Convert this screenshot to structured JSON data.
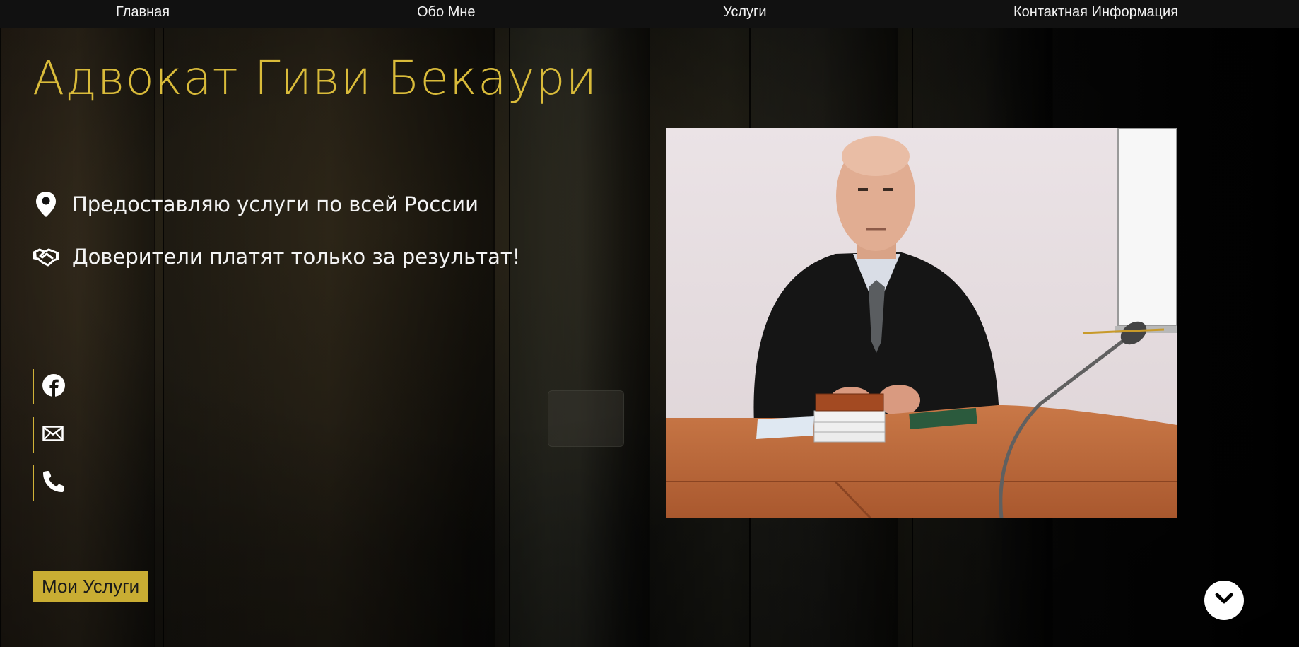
{
  "nav": {
    "items": [
      {
        "label": "Главная"
      },
      {
        "label": "Обо Мне"
      },
      {
        "label": "Услуги"
      },
      {
        "label": "Контактная Информация"
      }
    ]
  },
  "hero": {
    "title": "Адвокат Гиви Бекаури",
    "features": [
      {
        "icon": "map-pin-icon",
        "text": "Предоставляю услуги по всей России"
      },
      {
        "icon": "handshake-icon",
        "text": "Доверители платят только за результат!"
      }
    ],
    "social": [
      {
        "icon": "facebook-icon"
      },
      {
        "icon": "email-icon"
      },
      {
        "icon": "phone-icon"
      }
    ],
    "services_button": "Мои Услуги",
    "scroll_icon": "chevron-down-icon"
  },
  "colors": {
    "accent": "#d9bb3a",
    "button": "#c9ad33",
    "nav_bg": "#111111",
    "text": "#f3f3f3"
  }
}
